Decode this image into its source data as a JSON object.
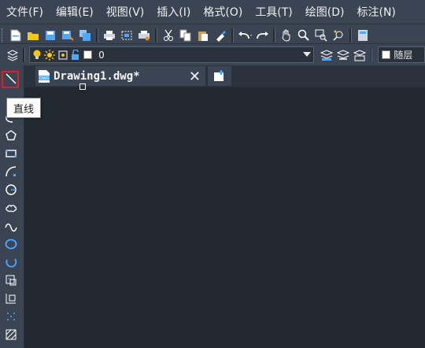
{
  "menu": {
    "items": [
      "文件(F)",
      "编辑(E)",
      "视图(V)",
      "插入(I)",
      "格式(O)",
      "工具(T)",
      "绘图(D)",
      "标注(N)"
    ]
  },
  "toolbar": {
    "layer_value": "0",
    "color_value": "随层"
  },
  "tabs": {
    "drawing_label": "Drawing1.dwg*",
    "close_glyph": "✕"
  },
  "tooltip": {
    "text": "直线"
  },
  "colors": {
    "menubar_bg": "#3b4453",
    "canvas_bg": "#212830",
    "highlight_border": "#e02020",
    "icon_blue": "#4fa8ff",
    "icon_yellow": "#f5c518",
    "icon_orange": "#f08a24"
  }
}
